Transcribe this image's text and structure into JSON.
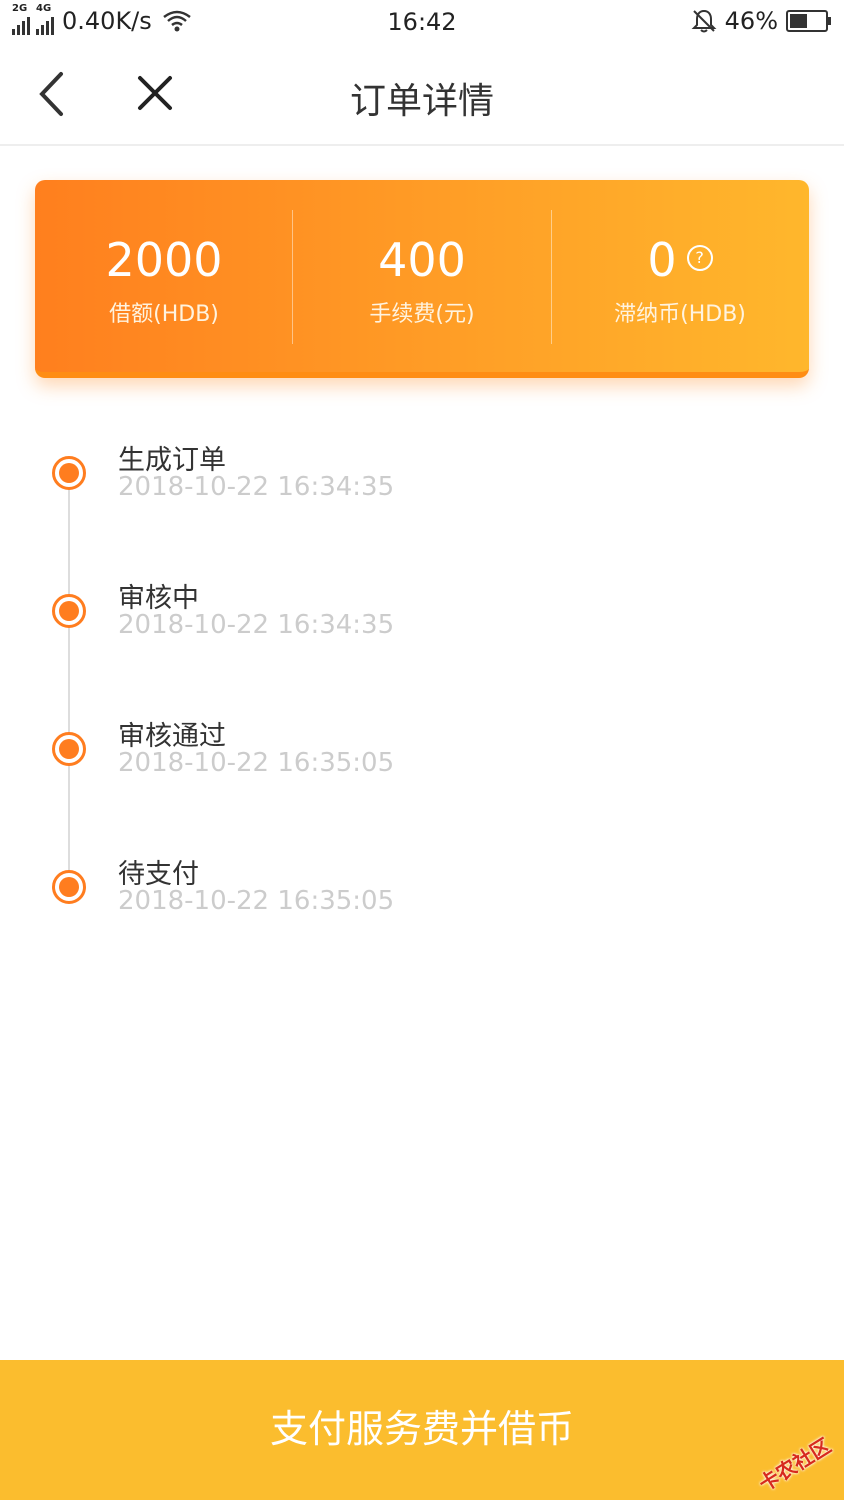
{
  "status_bar": {
    "net_2g": "2G",
    "net_4g": "4G",
    "speed": "0.40K/s",
    "time": "16:42",
    "battery": "46%"
  },
  "nav": {
    "title": "订单详情",
    "back_icon": "chevron-left-icon",
    "close_icon": "close-icon"
  },
  "summary": {
    "items": [
      {
        "value": "2000",
        "label": "借额(HDB)"
      },
      {
        "value": "400",
        "label": "手续费(元)"
      },
      {
        "value": "0",
        "label": "滞纳币(HDB)",
        "help": "?"
      }
    ]
  },
  "timeline": [
    {
      "title": "生成订单",
      "time": "2018-10-22 16:34:35"
    },
    {
      "title": "审核中",
      "time": "2018-10-22 16:34:35"
    },
    {
      "title": "审核通过",
      "time": "2018-10-22 16:35:05"
    },
    {
      "title": "待支付",
      "time": "2018-10-22 16:35:05"
    }
  ],
  "action": {
    "pay_label": "支付服务费并借币"
  },
  "watermark": "卡农社区",
  "colors": {
    "accent": "#ff7d1f",
    "button": "#fbbd2e"
  }
}
